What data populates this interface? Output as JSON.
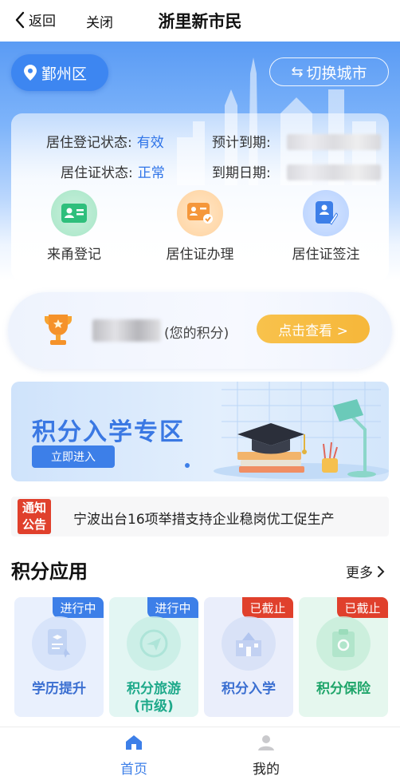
{
  "nav": {
    "back_label": "返回",
    "close_label": "关闭",
    "title": "浙里新市民"
  },
  "hero": {
    "district": "鄞州区",
    "switch_city": "切换城市"
  },
  "status": {
    "reg_label": "居住登记状态:",
    "reg_value": "有效",
    "expect_label": "预计到期:",
    "permit_label": "居住证状态:",
    "permit_value": "正常",
    "expire_label": "到期日期:"
  },
  "quick": [
    {
      "label": "来甬登记",
      "icon": "id-card-icon"
    },
    {
      "label": "居住证办理",
      "icon": "certificate-check-icon"
    },
    {
      "label": "居住证签注",
      "icon": "endorse-pen-icon"
    }
  ],
  "points": {
    "label": "(您的积分)",
    "button": "点击查看 >"
  },
  "banner": {
    "title": "积分入学专区",
    "button": "立即进入"
  },
  "notice": {
    "badge_top": "通知",
    "badge_bottom": "公告",
    "text": "宁波出台16项举措支持企业稳岗优工促生产"
  },
  "section": {
    "title": "积分应用",
    "more": "更多"
  },
  "apps": [
    {
      "label": "学历提升",
      "tag": "进行中",
      "tag_color": "#3d7fe8",
      "bg": "#e9f0fd",
      "text_color": "#3b6fd1"
    },
    {
      "label": "积分旅游\n(市级)",
      "label_line1": "积分旅游",
      "label_line2": "(市级)",
      "tag": "进行中",
      "tag_color": "#3d7fe8",
      "bg": "#e3f6f3",
      "text_color": "#1ea98a"
    },
    {
      "label": "积分入学",
      "tag": "已截止",
      "tag_color": "#e0402c",
      "bg": "#eaeefb",
      "text_color": "#3b6fd1"
    },
    {
      "label": "积分保险",
      "tag": "已截止",
      "tag_color": "#e0402c",
      "bg": "#e5f7ee",
      "text_color": "#1fa56a"
    }
  ],
  "tabs": [
    {
      "label": "首页",
      "active": true,
      "color": "#3d7fe8"
    },
    {
      "label": "我的",
      "active": false,
      "color": "#222222"
    }
  ]
}
